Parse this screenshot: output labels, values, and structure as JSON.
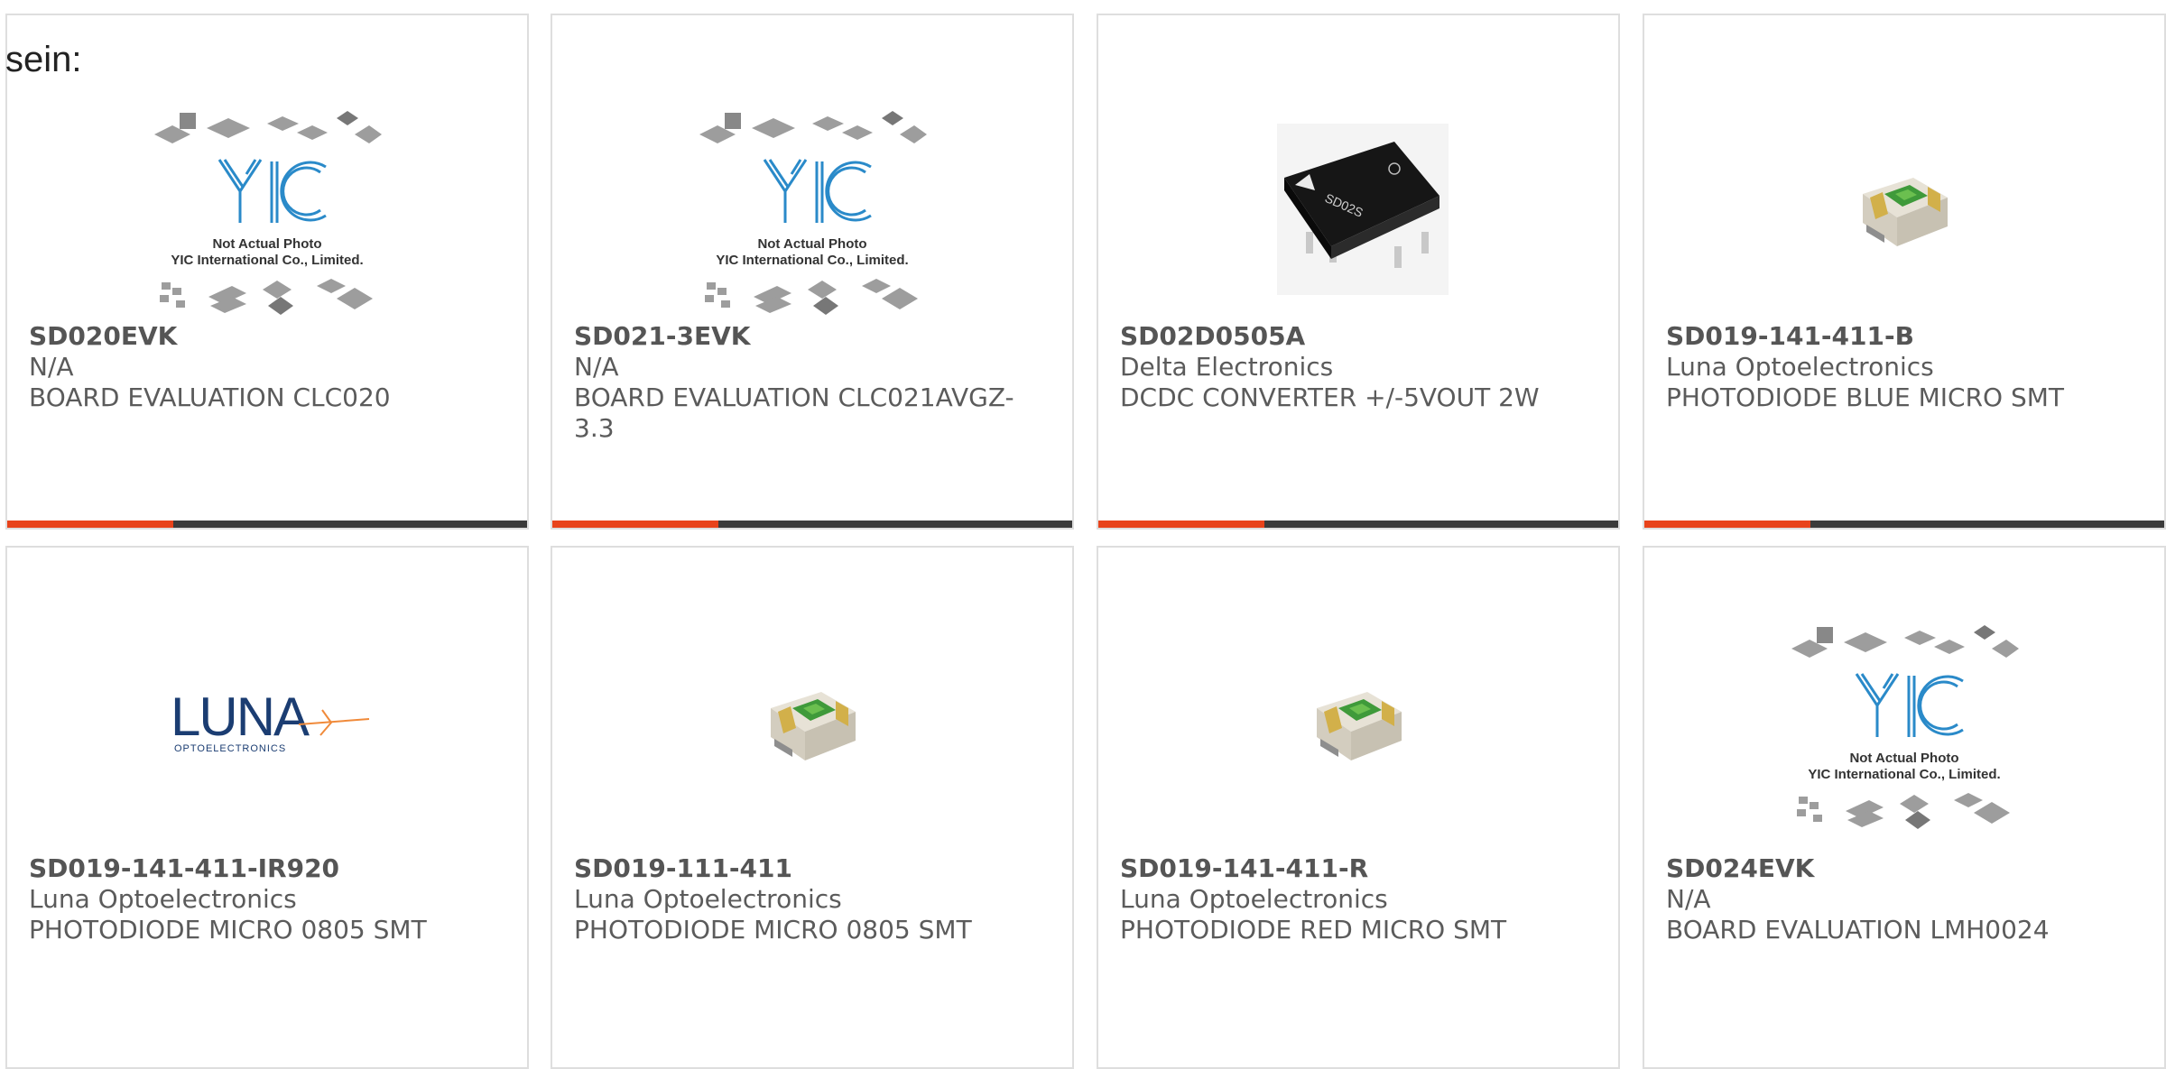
{
  "intro_text": "sein:",
  "colors": {
    "accent": "#e8431b",
    "bar": "#3b3b3b",
    "border": "#dedede"
  },
  "placeholder_caption": [
    "Not Actual Photo",
    "YIC International Co., Limited."
  ],
  "products": [
    {
      "part": "SD020EVK",
      "manufacturer": "N/A",
      "description": "BOARD EVALUATION CLC020",
      "image": "yic-placeholder"
    },
    {
      "part": "SD021-3EVK",
      "manufacturer": "N/A",
      "description": "BOARD EVALUATION CLC021AVGZ-3.3",
      "image": "yic-placeholder"
    },
    {
      "part": "SD02D0505A",
      "manufacturer": "Delta Electronics",
      "description": "DCDC CONVERTER +/-5VOUT 2W",
      "image": "dcdc-module"
    },
    {
      "part": "SD019-141-411-B",
      "manufacturer": "Luna Optoelectronics",
      "description": "PHOTODIODE BLUE MICRO SMT",
      "image": "smt-photodiode"
    },
    {
      "part": "SD019-141-411-IR920",
      "manufacturer": "Luna Optoelectronics",
      "description": "PHOTODIODE MICRO 0805 SMT",
      "image": "luna-logo"
    },
    {
      "part": "SD019-111-411",
      "manufacturer": "Luna Optoelectronics",
      "description": "PHOTODIODE MICRO 0805 SMT",
      "image": "smt-photodiode"
    },
    {
      "part": "SD019-141-411-R",
      "manufacturer": "Luna Optoelectronics",
      "description": "PHOTODIODE RED MICRO SMT",
      "image": "smt-photodiode"
    },
    {
      "part": "SD024EVK",
      "manufacturer": "N/A",
      "description": "BOARD EVALUATION LMH0024",
      "image": "yic-placeholder"
    }
  ],
  "module_marking": "SD02S",
  "luna_logo": {
    "word": "LUNA",
    "sub": "OPTOELECTRONICS"
  }
}
